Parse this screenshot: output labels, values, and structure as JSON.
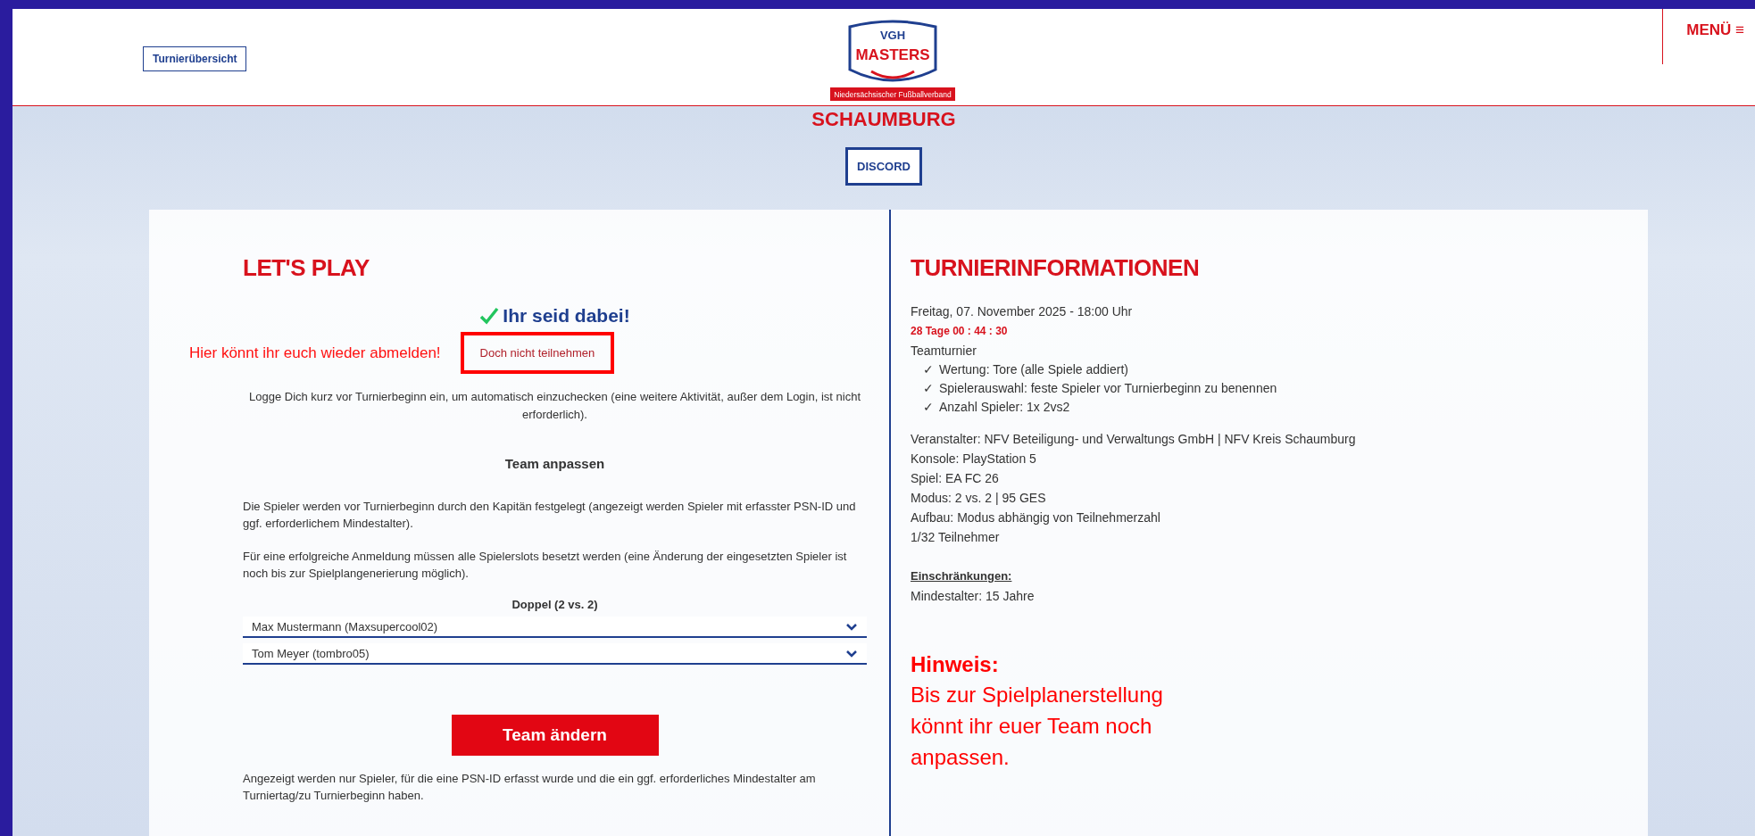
{
  "header": {
    "overview_button": "Turnierübersicht",
    "logo": {
      "top": "VGH",
      "main": "MASTERS",
      "strip": "Niedersächsischer Fußballverband"
    },
    "menu": {
      "label": "MENÜ",
      "icon": "≡"
    }
  },
  "hero": {
    "title": "SCHAUMBURG",
    "discord_button": "DISCORD"
  },
  "lets_play": {
    "title": "LET'S PLAY",
    "status": "Ihr seid dabei!",
    "annotation": "Hier könnt ihr euch wieder abmelden!",
    "withdraw_link": "Doch nicht teilnehmen",
    "checkin_note": "Logge Dich kurz vor Turnierbeginn ein, um automatisch einzuchecken (eine weitere Aktivität, außer dem Login, ist nicht erforderlich).",
    "team_heading": "Team anpassen",
    "paragraphs": [
      "Die Spieler werden vor Turnierbeginn durch den Kapitän festgelegt (angezeigt werden Spieler mit erfasster PSN-ID und ggf. erforderlichem Mindestalter).",
      "Für eine erfolgreiche Anmeldung müssen alle Spielerslots besetzt werden (eine Änderung der eingesetzten Spieler ist noch bis zur Spielplangenerierung möglich)."
    ],
    "slot_label": "Doppel (2 vs. 2)",
    "players": [
      {
        "value": "Max Mustermann (Maxsupercool02)"
      },
      {
        "value": "Tom Meyer (tombro05)"
      }
    ],
    "submit_button": "Team ändern",
    "footnote": "Angezeigt werden nur Spieler, für die eine PSN-ID erfasst wurde und die ein ggf. erforderliches Mindestalter am Turniertag/zu Turnierbeginn haben."
  },
  "info": {
    "title": "TURNIERINFORMATIONEN",
    "date": "Freitag, 07. November 2025 - 18:00 Uhr",
    "countdown": "28 Tage 00 : 44 : 30",
    "type": "Teamturnier",
    "features": [
      {
        "mark": "✓",
        "text": "Wertung: Tore (alle Spiele addiert)"
      },
      {
        "mark": "✓",
        "text": "Spielerauswahl: feste Spieler vor Turnierbeginn zu benennen"
      },
      {
        "mark": "✓",
        "text": "Anzahl Spieler: 1x 2vs2"
      }
    ],
    "details": [
      "Veranstalter: NFV Beteiligung- und Verwaltungs GmbH | NFV Kreis Schaumburg",
      "Konsole: PlayStation 5",
      "Spiel: EA FC 26",
      "Modus: 2 vs. 2 | 95 GES",
      "Aufbau: Modus abhängig von Teilnehmerzahl",
      "1/32 Teilnehmer"
    ],
    "restrictions_heading": "Einschränkungen:",
    "restrictions": [
      "Mindestalter: 15 Jahre"
    ],
    "hint_title": "Hinweis:",
    "hint_text": "Bis zur Spielplanerstellung könnt ihr euer Team noch anpassen."
  }
}
